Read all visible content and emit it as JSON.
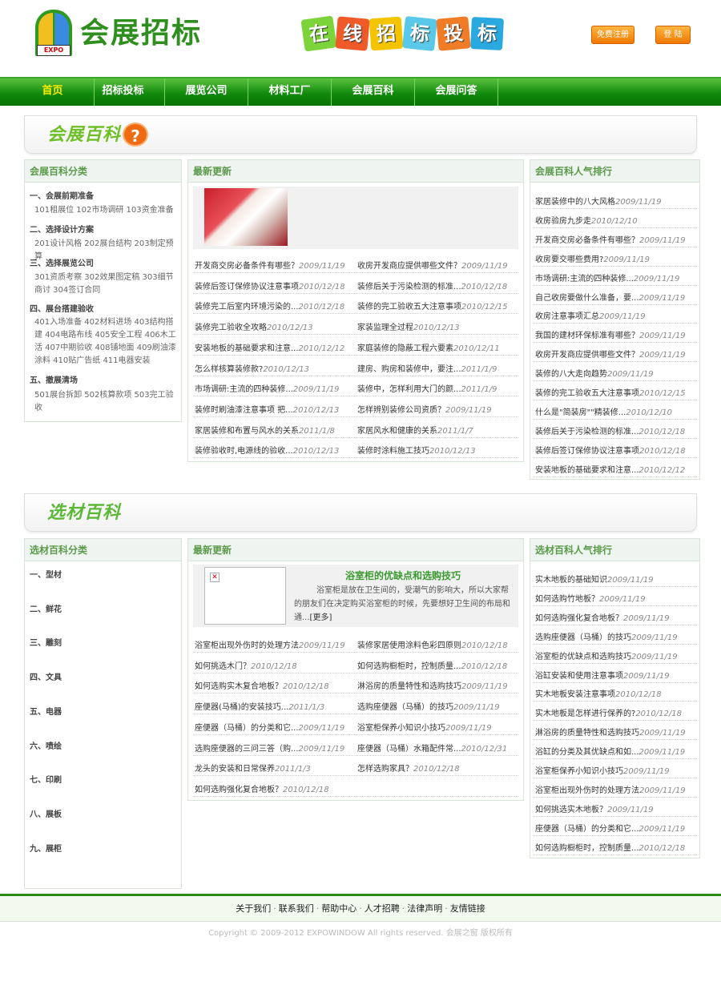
{
  "header": {
    "logo_text": "会展招标",
    "logo_badge": "EXPO",
    "slogan_chars": [
      "在",
      "线",
      "招",
      "标",
      "投",
      "标"
    ],
    "register_label": "免费注册",
    "login_label": "登 陆"
  },
  "nav": {
    "items": [
      "首页",
      "招标投标",
      "展览公司",
      "材料工厂",
      "会展百科",
      "会展问答"
    ]
  },
  "section1": {
    "banner_title": "会展百科",
    "banner_icon": "question-icon",
    "categories": {
      "title": "会展百科分类",
      "groups": [
        {
          "name": "一、会展前期准备",
          "items": "101租展位 102市场调研 103资金准备"
        },
        {
          "name": "二、选择设计方案",
          "items": "201设计风格 202展台结构 203制定预算"
        },
        {
          "name": "三、选择展览公司",
          "items": "301资质考察 302效果图定稿 303细节商讨 304签订合同"
        },
        {
          "name": "四、展台搭建验收",
          "items": "401入场准备 402材料进场 403结构搭建 404电路布线 405安全工程 406木工活 407中期验收 408铺地面 409刷油漆涂料 410贴广告纸 411电器安装"
        },
        {
          "name": "五、撤展清场",
          "items": "501展台拆卸 502核算款项 503完工验收"
        }
      ]
    },
    "latest": {
      "title": "最新更新",
      "rows": [
        [
          {
            "t": "开发商交房必备条件有哪些？",
            "d": "2009/11/19"
          },
          {
            "t": "收房开发商应提供哪些文件？",
            "d": "2009/11/19"
          }
        ],
        [
          {
            "t": "装修后签订保修协议注意事项",
            "d": "2010/12/18"
          },
          {
            "t": "装修后关于污染检测的标准...",
            "d": "2010/12/18"
          }
        ],
        [
          {
            "t": "装修完工后室内环境污染的...",
            "d": "2010/12/18"
          },
          {
            "t": "装修的完工验收五大注意事项",
            "d": "2010/12/15"
          }
        ],
        [
          {
            "t": "装修完工验收全攻略",
            "d": "2010/12/13"
          },
          {
            "t": "家装监理全过程",
            "d": "2010/12/13"
          }
        ],
        [
          {
            "t": "安装地板的基础要求和注意...",
            "d": "2010/12/12"
          },
          {
            "t": "家庭装修的隐蔽工程六要素",
            "d": "2010/12/11"
          }
        ],
        [
          {
            "t": "怎么样核算装修款?",
            "d": "2010/12/13"
          },
          {
            "t": "建房、购房和装修中，要注...",
            "d": "2011/1/9"
          }
        ],
        [
          {
            "t": "市场调研:主流的四种装修...",
            "d": "2009/11/19"
          },
          {
            "t": "装修中，怎样利用大门的颜...",
            "d": "2011/1/9"
          }
        ],
        [
          {
            "t": "装修时刷油漆注意事项 把...",
            "d": "2010/12/13"
          },
          {
            "t": "怎样辨别装修公司资质？",
            "d": "2009/11/19"
          }
        ],
        [
          {
            "t": "家居装修和布置与风水的关系",
            "d": "2011/1/8"
          },
          {
            "t": "家居风水和健康的关系",
            "d": "2011/1/7"
          }
        ],
        [
          {
            "t": "装修验收时,电源线的验收...",
            "d": "2010/12/13"
          },
          {
            "t": "装修时涂料施工技巧",
            "d": "2010/12/13"
          }
        ]
      ]
    },
    "ranking": {
      "title": "会展百科人气排行",
      "items": [
        {
          "t": "家居装修中的八大风格",
          "d": "2009/11/19"
        },
        {
          "t": "收房验房九步走",
          "d": "2010/12/10"
        },
        {
          "t": "开发商交房必备条件有哪些？",
          "d": "2009/11/19"
        },
        {
          "t": "收房要交哪些费用?",
          "d": "2009/11/19"
        },
        {
          "t": "市场调研:主流的四种装修...",
          "d": "2009/11/19"
        },
        {
          "t": "自己收房要做什么准备，要...",
          "d": "2009/11/19"
        },
        {
          "t": "收房注意事项汇总",
          "d": "2009/11/19"
        },
        {
          "t": "我国的建材环保标准有哪些？",
          "d": "2009/11/19"
        },
        {
          "t": "收房开发商应提供哪些文件？",
          "d": "2009/11/19"
        },
        {
          "t": "装修的八大走向趋势",
          "d": "2009/11/19"
        },
        {
          "t": "装修的完工验收五大注意事项",
          "d": "2010/12/15"
        },
        {
          "t": "什么是\"简装房\"\"精装修...",
          "d": "2010/12/10"
        },
        {
          "t": "装修后关于污染检测的标准...",
          "d": "2010/12/18"
        },
        {
          "t": "装修后签订保修协议注意事项",
          "d": "2010/12/18"
        },
        {
          "t": "安装地板的基础要求和注意...",
          "d": "2010/12/12"
        }
      ]
    }
  },
  "section2": {
    "banner_title": "选材百科",
    "categories": {
      "title": "选材百科分类",
      "items": [
        "一、型材",
        "二、鲜花",
        "三、雕刻",
        "四、文具",
        "五、电器",
        "六、喷绘",
        "七、印刷",
        "八、展板",
        "九、展柜"
      ]
    },
    "latest": {
      "title": "最新更新",
      "feature_title": "浴室柜的优缺点和选购技巧",
      "feature_text": "浴室柜是放在卫生间的，受潮气的影响大，所以大家帮的朋友们在决定购买浴室柜的时候，先要想好卫生间的布局和通...",
      "feature_more": "[更多]",
      "broken_image": "broken-image-icon",
      "rows": [
        [
          {
            "t": "浴室柜出现外伤时的处理方法",
            "d": "2009/11/19"
          },
          {
            "t": "装修家居使用涂料色彩四原则",
            "d": "2010/12/18"
          }
        ],
        [
          {
            "t": "如何挑选木门？",
            "d": "2010/12/18"
          },
          {
            "t": "如何选购橱柜时，控制质量...",
            "d": "2010/12/18"
          }
        ],
        [
          {
            "t": "如何选购实木复合地板？",
            "d": "2010/12/18"
          },
          {
            "t": "淋浴房的质量特性和选购技巧",
            "d": "2009/11/19"
          }
        ],
        [
          {
            "t": "座便器(马桶)的安装技巧...",
            "d": "2011/1/3"
          },
          {
            "t": "选购座便器（马桶）的技巧",
            "d": "2009/11/19"
          }
        ],
        [
          {
            "t": "座便器（马桶）的分类和它...",
            "d": "2009/11/19"
          },
          {
            "t": "浴室柜保养小知识小技巧",
            "d": "2009/11/19"
          }
        ],
        [
          {
            "t": "选购座便器的三问三答（购...",
            "d": "2009/11/19"
          },
          {
            "t": "座便器（马桶）水箱配件常...",
            "d": "2010/12/31"
          }
        ],
        [
          {
            "t": "龙头的安装和日常保养",
            "d": "2011/1/3"
          },
          {
            "t": "怎样选购家具？",
            "d": "2010/12/18"
          }
        ],
        [
          {
            "t": "如何选购强化复合地板？",
            "d": "2010/12/18"
          },
          {
            "t": "",
            "d": ""
          }
        ]
      ]
    },
    "ranking": {
      "title": "选材百科人气排行",
      "items": [
        {
          "t": "实木地板的基础知识",
          "d": "2009/11/19"
        },
        {
          "t": "如何选购竹地板？",
          "d": "2009/11/19"
        },
        {
          "t": "如何选购强化复合地板？",
          "d": "2009/11/19"
        },
        {
          "t": "选购座便器（马桶）的技巧",
          "d": "2009/11/19"
        },
        {
          "t": "浴室柜的优缺点和选购技巧",
          "d": "2009/11/19"
        },
        {
          "t": "浴缸安装和使用注意事项",
          "d": "2009/11/19"
        },
        {
          "t": "实木地板安装注意事项",
          "d": "2010/12/18"
        },
        {
          "t": "实木地板是怎样进行保养的?",
          "d": "2010/12/18"
        },
        {
          "t": "淋浴房的质量特性和选购技巧",
          "d": "2009/11/19"
        },
        {
          "t": "浴缸的分类及其优缺点和如...",
          "d": "2009/11/19"
        },
        {
          "t": "浴室柜保养小知识小技巧",
          "d": "2009/11/19"
        },
        {
          "t": "浴室柜出现外伤时的处理方法",
          "d": "2009/11/19"
        },
        {
          "t": "如何挑选实木地板？",
          "d": "2009/11/19"
        },
        {
          "t": "座便器（马桶）的分类和它...",
          "d": "2009/11/19"
        },
        {
          "t": "如何选购橱柜时，控制质量...",
          "d": "2010/12/18"
        }
      ]
    }
  },
  "footer": {
    "links": [
      "关于我们",
      "联系我们",
      "帮助中心",
      "人才招聘",
      "法律声明",
      "友情链接"
    ],
    "separator": "·",
    "copyright": "Copyright © 2009-2012 EXPOWINDOW All rights reserved. 会展之窗 版权所有"
  }
}
